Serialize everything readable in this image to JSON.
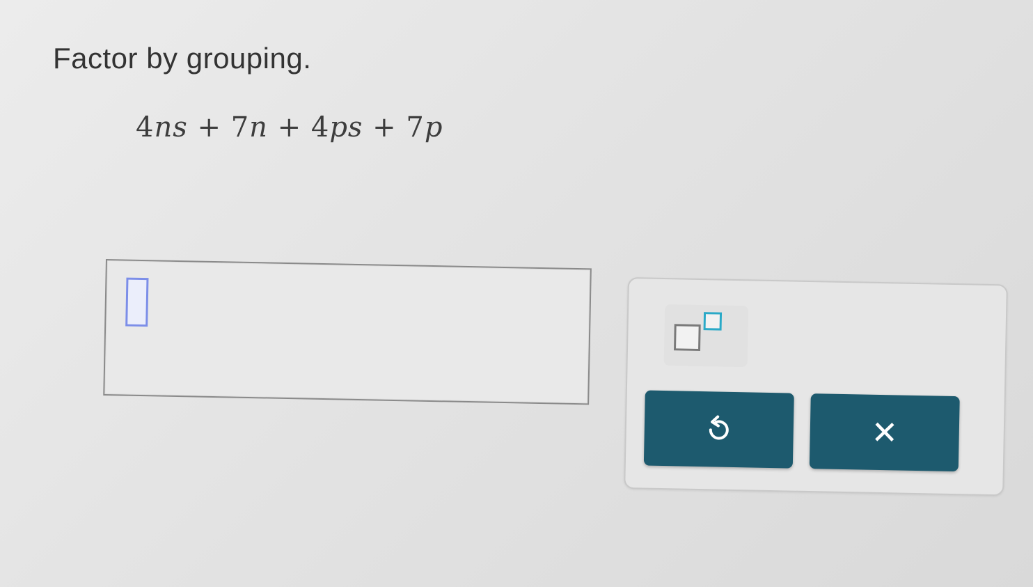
{
  "question": {
    "prompt": "Factor by grouping.",
    "expression_parts": [
      {
        "text": "4",
        "italic": false
      },
      {
        "text": "ns",
        "italic": true
      },
      {
        "text": " + 7",
        "italic": false
      },
      {
        "text": "n",
        "italic": true
      },
      {
        "text": " + 4",
        "italic": false
      },
      {
        "text": "ps",
        "italic": true
      },
      {
        "text": " + 7",
        "italic": false
      },
      {
        "text": "p",
        "italic": true
      }
    ]
  },
  "answer": {
    "value": ""
  },
  "toolbar": {
    "exponent_icon": "exponent-template-icon",
    "undo_icon": "undo-icon",
    "clear_icon": "close-icon",
    "clear_glyph": "✕",
    "colors": {
      "button_bg": "#1d5a6e",
      "slot_border": "#7c8ee8",
      "superscript_border": "#2aa9c7"
    }
  }
}
